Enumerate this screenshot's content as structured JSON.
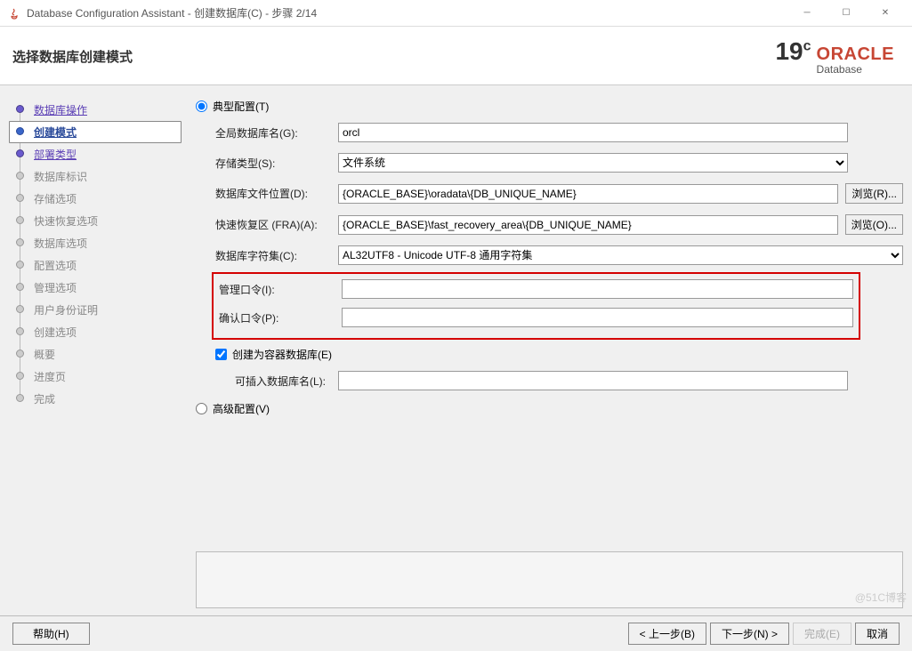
{
  "window": {
    "title": "Database Configuration Assistant - 创建数据库(C) - 步骤 2/14"
  },
  "header": {
    "title": "选择数据库创建模式",
    "brand_version": "19",
    "brand_suffix": "c",
    "brand_name": "ORACLE",
    "brand_sub": "Database"
  },
  "steps": [
    {
      "label": "数据库操作",
      "state": "done"
    },
    {
      "label": "创建模式",
      "state": "active"
    },
    {
      "label": "部署类型",
      "state": "done"
    },
    {
      "label": "数据库标识",
      "state": ""
    },
    {
      "label": "存储选项",
      "state": ""
    },
    {
      "label": "快速恢复选项",
      "state": ""
    },
    {
      "label": "数据库选项",
      "state": ""
    },
    {
      "label": "配置选项",
      "state": ""
    },
    {
      "label": "管理选项",
      "state": ""
    },
    {
      "label": "用户身份证明",
      "state": ""
    },
    {
      "label": "创建选项",
      "state": ""
    },
    {
      "label": "概要",
      "state": ""
    },
    {
      "label": "进度页",
      "state": ""
    },
    {
      "label": "完成",
      "state": ""
    }
  ],
  "form": {
    "typical_label": "典型配置(T)",
    "advanced_label": "高级配置(V)",
    "global_db_label": "全局数据库名(G):",
    "global_db_value": "orcl",
    "storage_label": "存储类型(S):",
    "storage_value": "文件系统",
    "dbfiles_label": "数据库文件位置(D):",
    "dbfiles_value": "{ORACLE_BASE}\\oradata\\{DB_UNIQUE_NAME}",
    "fra_label": "快速恢复区 (FRA)(A):",
    "fra_value": "{ORACLE_BASE}\\fast_recovery_area\\{DB_UNIQUE_NAME}",
    "charset_label": "数据库字符集(C):",
    "charset_value": "AL32UTF8 - Unicode UTF-8 通用字符集",
    "admin_pwd_label": "管理口令(I):",
    "admin_pwd_value": "",
    "confirm_pwd_label": "确认口令(P):",
    "confirm_pwd_value": "",
    "cdb_label": "创建为容器数据库(E)",
    "pdb_label": "可插入数据库名(L):",
    "pdb_value": "",
    "browse_r": "浏览(R)...",
    "browse_o": "浏览(O)..."
  },
  "footer": {
    "help": "帮助(H)",
    "back": "< 上一步(B)",
    "next": "下一步(N) >",
    "finish": "完成(E)",
    "cancel": "取消"
  },
  "watermark": "@51C博客"
}
